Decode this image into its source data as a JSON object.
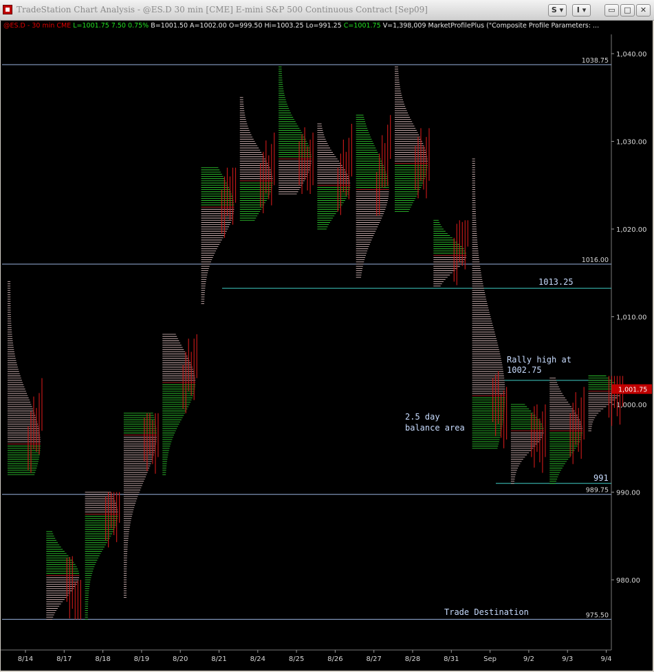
{
  "window": {
    "title": "TradeStation Chart Analysis - @ES.D 30 min [CME] E-mini S&P 500 Continuous Contract [Sep09]",
    "buttons": {
      "symbol": "S",
      "interval": "I",
      "minimize": "▭",
      "maximize": "□",
      "close": "✕"
    },
    "icons": {
      "app": "tradestation-icon",
      "minimize": "minimize-icon",
      "maximize": "maximize-icon",
      "close": "close-icon"
    }
  },
  "status": {
    "symbol": "@ES.D - 30 min  CME",
    "last": "L=1001.75",
    "change": "7.50",
    "change_pct": "0.75%",
    "bid": "B=1001.50",
    "ask": "A=1002.00",
    "open": "O=999.50",
    "high": "Hi=1003.25",
    "low": "Lo=991.25",
    "close": "C=1001.75",
    "volume": "V=1,398,009",
    "study": "MarketProfilePlus (\"Composite Profile Parameters: ..."
  },
  "colors": {
    "background": "#000000",
    "profile_up": "#33dd33",
    "profile_down": "#e8c8c8",
    "poc": "#e03030",
    "bar": "#c01818",
    "hline": "#9ab4e0",
    "cyan_line": "#40d0c8",
    "axis_text": "#d8d8d8",
    "annotation": "#c8dcff",
    "current_price_label": "#c00000"
  },
  "chart_data": {
    "type": "market-profile",
    "ylim": [
      970,
      1043
    ],
    "y_ticks": [
      {
        "value": 980,
        "label": "980.00"
      },
      {
        "value": 990,
        "label": "990.00"
      },
      {
        "value": 1000,
        "label": "1,000.00"
      },
      {
        "value": 1010,
        "label": "1,010.00"
      },
      {
        "value": 1020,
        "label": "1,020.00"
      },
      {
        "value": 1030,
        "label": "1,030.00"
      },
      {
        "value": 1040,
        "label": "1,040.00"
      }
    ],
    "x_labels": [
      "8/14",
      "8/17",
      "8/18",
      "8/19",
      "8/20",
      "8/21",
      "8/24",
      "8/25",
      "8/26",
      "8/27",
      "8/28",
      "8/31",
      "Sep",
      "9/2",
      "9/3",
      "9/4"
    ],
    "last_price": "1,001.75",
    "last_value": 1001.75,
    "horizontal_levels": [
      {
        "value": 1038.75,
        "label": "1038.75"
      },
      {
        "value": 1016.0,
        "label": "1016.00"
      },
      {
        "value": 989.75,
        "label": "989.75"
      },
      {
        "value": 975.5,
        "label": "975.50"
      }
    ],
    "annotations": {
      "level_1013": {
        "value": 1013.25,
        "text": "1013.25"
      },
      "rally_high_1": {
        "value": 1002.75,
        "text": "Rally high at"
      },
      "rally_high_2": {
        "text": "1002.75"
      },
      "balance_1": {
        "text": "2.5 day"
      },
      "balance_2": {
        "text": "balance area"
      },
      "level_991": {
        "value": 991,
        "text": "991"
      },
      "destination": {
        "text": "Trade Destination"
      }
    },
    "sessions": [
      {
        "date": "8/14",
        "low": 992,
        "high": 1014,
        "poc": 995.5,
        "close": 999
      },
      {
        "date": "8/17",
        "low": 975.5,
        "high": 985.5,
        "poc": 980.5,
        "close": 976
      },
      {
        "date": "8/18",
        "low": 975.5,
        "high": 990,
        "poc": 987.5,
        "close": 988.5
      },
      {
        "date": "8/19",
        "low": 978,
        "high": 999,
        "poc": 996.5,
        "close": 996
      },
      {
        "date": "8/20",
        "low": 992,
        "high": 1008,
        "poc": 1002.5,
        "close": 1005
      },
      {
        "date": "8/21",
        "low": 1011.5,
        "high": 1027,
        "poc": 1022.5,
        "close": 1025
      },
      {
        "date": "8/24",
        "low": 1021,
        "high": 1035,
        "poc": 1025.5,
        "close": 1027
      },
      {
        "date": "8/25",
        "low": 1024,
        "high": 1038.5,
        "poc": 1028,
        "close": 1027
      },
      {
        "date": "8/26",
        "low": 1020,
        "high": 1032,
        "poc": 1025,
        "close": 1028
      },
      {
        "date": "8/27",
        "low": 1014.5,
        "high": 1033,
        "poc": 1024.5,
        "close": 1030
      },
      {
        "date": "8/28",
        "low": 1022,
        "high": 1038.5,
        "poc": 1027.5,
        "close": 1027.5
      },
      {
        "date": "8/31",
        "low": 1013.5,
        "high": 1021,
        "poc": 1017,
        "close": 1020
      },
      {
        "date": "Sep",
        "low": 995,
        "high": 1028,
        "poc": 1001,
        "close": 998
      },
      {
        "date": "9/2",
        "low": 991,
        "high": 1000,
        "poc": 997,
        "close": 996
      },
      {
        "date": "9/3",
        "low": 991,
        "high": 1003,
        "poc": 997,
        "close": 998
      },
      {
        "date": "9/4",
        "low": 997,
        "high": 1003.25,
        "poc": 1001.5,
        "close": 1001.75
      }
    ]
  }
}
